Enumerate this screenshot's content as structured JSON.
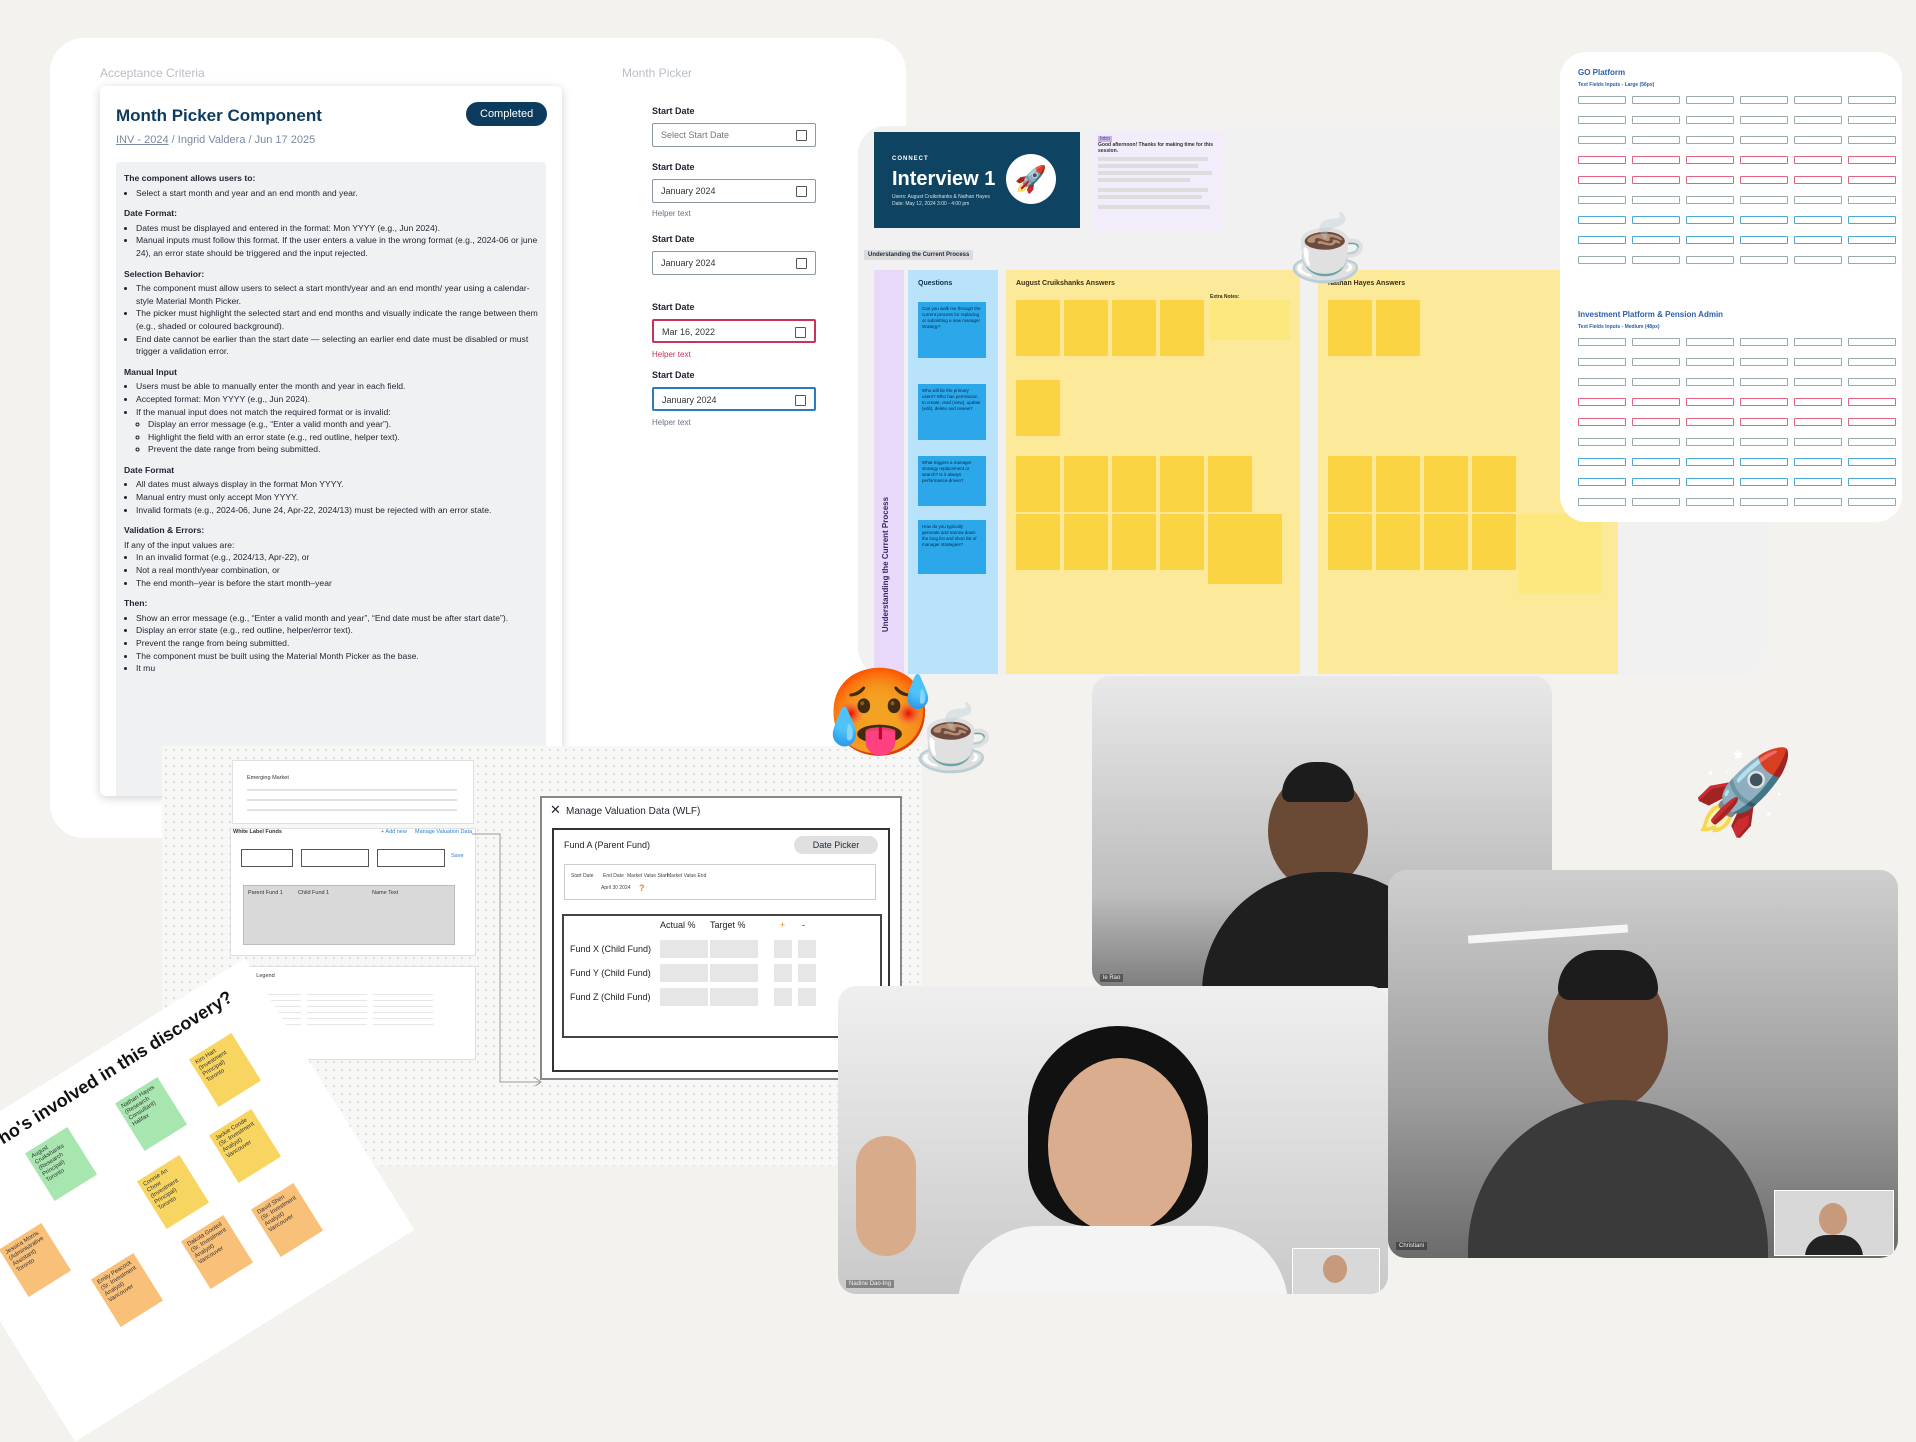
{
  "acceptance": {
    "board_label": "Acceptance Criteria",
    "title": "Month Picker Component",
    "status": "Completed",
    "ticket": "INV - 2024",
    "author": "Ingrid Valdera",
    "date": "Jun 17 2025",
    "sep": "/",
    "intro_h": "The component allows users to:",
    "intro_1": "Select a start month and year and an end month and year.",
    "df_h": "Date Format:",
    "df_1": "Dates must be displayed and entered in the format: Mon YYYY (e.g., Jun 2024).",
    "df_2": "Manual inputs must follow this format. If the user enters a value in the wrong format (e.g., 2024-06 or june 24), an error state should be triggered and the input rejected.",
    "sb_h": "Selection Behavior:",
    "sb_1": "The component must allow users to select a start month/year and an end month/ year using a calendar-style Material Month Picker.",
    "sb_2": "The picker must highlight the selected start and end months and visually indicate the range between them (e.g., shaded or coloured background).",
    "sb_3": "End date cannot be earlier than the start date — selecting an earlier end date must be disabled or must trigger a validation error.",
    "mi_h": "Manual Input",
    "mi_1": "Users must be able to manually enter the month and year in each field.",
    "mi_2": "Accepted format: Mon YYYY (e.g., Jun 2024).",
    "mi_3": "If the manual input does not match the required format or is invalid:",
    "mi_3a": "Display an error message (e.g., “Enter a valid month and year”).",
    "mi_3b": "Highlight the field with an error state (e.g., red outline, helper text).",
    "mi_3c": "Prevent the date range from being submitted.",
    "df2_h": "Date Format",
    "df2_1": "All dates must always display in the format Mon YYYY.",
    "df2_2": "Manual entry must only accept Mon YYYY.",
    "df2_3": "Invalid formats (e.g., 2024-06, June 24, Apr-22, 2024/13) must be rejected with an error state.",
    "ve_h": "Validation & Errors:",
    "ve_p": "If any of the input values are:",
    "ve_1": "In an invalid format (e.g., 2024/13, Apr-22), or",
    "ve_2": "Not a real month/year combination, or",
    "ve_3": "The end month–year is before the start month–year",
    "th_h": "Then:",
    "th_1": "Show an error message (e.g., “Enter a valid month and year”, “End date must be after start date”).",
    "th_2": "Display an error state (e.g., red outline, helper/error text).",
    "th_3": "Prevent the range from being submitted.",
    "th_4": "The component must be built using the Material Month Picker as the base.",
    "th_5": "It mu"
  },
  "month_picker": {
    "board_label": "Month Picker",
    "fields": [
      {
        "label": "Start Date",
        "value": "Select Start Date",
        "helper": "",
        "state": "placeholder"
      },
      {
        "label": "Start Date",
        "value": "January 2024",
        "helper": "Helper text",
        "state": "default"
      },
      {
        "label": "Start Date",
        "value": "January 2024",
        "helper": "",
        "state": "default"
      },
      {
        "label": "Start Date",
        "value": "Mar 16, 2022",
        "helper": "Helper text",
        "state": "error"
      },
      {
        "label": "Start Date",
        "value": "January 2024",
        "helper": "Helper text",
        "state": "focus"
      }
    ]
  },
  "interview": {
    "brand": "CONNECT",
    "title": "Interview 1",
    "sub1": "Users: August Cruikshanks & Nathan Hayes",
    "sub2": "Date: May 12, 2024 3:00 - 4:00 pm",
    "intro_tag": "Intro",
    "intro_head": "Good afternoon! Thanks for making time for this session.",
    "section": "Understanding the Current Process",
    "side_label": "Understanding the Current Process",
    "questions_h": "Questions",
    "q1": "Can you walk me through the current process for replacing or submitting a new manager strategy?",
    "q2": "Who will be the primary users? Who has permission to create, read (view), update (edit), delete and review?",
    "q3": "What triggers a manager strategy replacement or search? Is it always performance-driven?",
    "q4": "How do you typically generate and narrow down the long list and short list of manager strategies?",
    "a1_h": "August Cruikshanks Answers",
    "a2_h": "Nathan Hayes Answers",
    "extra": "Extra Notes:"
  },
  "go_platform": {
    "title": "GO Platform",
    "sub": "Text Fields Inputs - Large (56px)",
    "title2": "Investment Platform & Pension Admin",
    "sub2": "Text Fields Inputs - Medium (48px)"
  },
  "wireframe": {
    "emerging": "Emerging Market",
    "wl_funds": "White Label Funds",
    "add_new": "+ Add new",
    "manage": "Manage Valuation Data",
    "parent": "Parent Fund 1",
    "child": "Child Fund 1",
    "name_text": "Name Text",
    "save": "Save",
    "legend": "Entity Legend"
  },
  "manage_valuation": {
    "title": "Manage Valuation Data (WLF)",
    "fund": "Fund A (Parent Fund)",
    "date_picker": "Date Picker",
    "h_start": "Start Date",
    "h_end": "End Date",
    "h_mvs": "Market Value Start",
    "h_mve": "Market Value End",
    "date_val": "April 30 2024",
    "qmark": "?",
    "actual": "Actual %",
    "target": "Target %",
    "plus": "+",
    "minus": "-",
    "funds": [
      "Fund X (Child Fund)",
      "Fund Y (Child Fund)",
      "Fund Z (Child Fund)"
    ]
  },
  "team": {
    "title": "Who's involved in this discovery?",
    "people": [
      {
        "name": "Kim Hart (Investment Principal) Toronto",
        "color": "#f7d560"
      },
      {
        "name": "Nathan Hayes (Research Consultant) Halifax",
        "color": "#a8e6b0"
      },
      {
        "name": "August Cruikshanks (Research Principal) Toronto",
        "color": "#a8e6b0"
      },
      {
        "name": "Connie An Chow (Investment Principal) Toronto",
        "color": "#f7d560"
      },
      {
        "name": "Jackie Conde (Sr. Investment Analyst) Vancouver",
        "color": "#f7d560"
      },
      {
        "name": "Dakota Gooteil (Sr. Investment Analyst) Vancouver",
        "color": "#f9c07a"
      },
      {
        "name": "David Shen (Sr. Investment Analyst) Vancouver",
        "color": "#f9c07a"
      },
      {
        "name": "Jessica Morris (Administrative Assistant) Toronto",
        "color": "#f9c07a"
      },
      {
        "name": "Emily Peacock (Sr. Investment Analyst) Vancouver",
        "color": "#f9c07a"
      }
    ]
  },
  "video": {
    "name1": "le Rao",
    "name2": "Nadine Dao-Ing",
    "name3": "Christiani"
  },
  "emojis": {
    "hot_face": "🥵",
    "coffee": "☕",
    "rocket": "🚀"
  }
}
